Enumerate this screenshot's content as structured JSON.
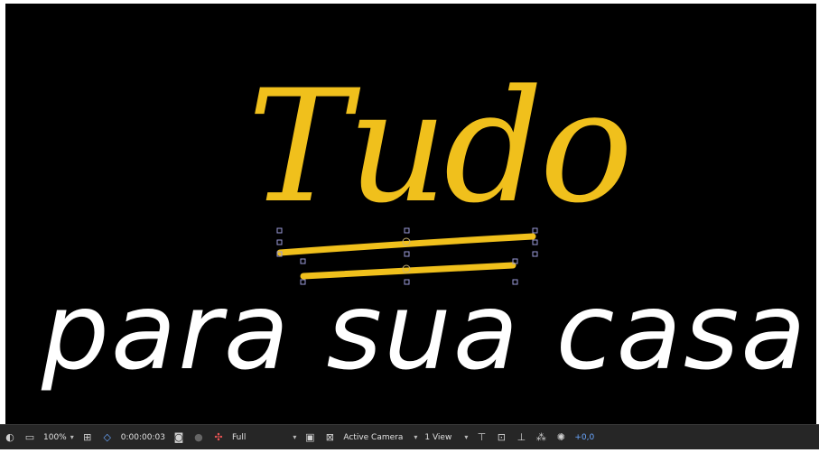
{
  "composition": {
    "title_line1": "Tudo",
    "title_line2": "para sua casa",
    "accent_color": "#f0c01c",
    "text_color": "#ffffff",
    "background": "#000000"
  },
  "toolbar": {
    "zoom": "100%",
    "timecode": "0:00:00:03",
    "resolution": "Full",
    "camera": "Active Camera",
    "views": "1 View",
    "exposure": "+0,0",
    "icons": [
      "toggle-alpha-icon",
      "monitor-icon",
      "grid-icon",
      "mask-icon",
      "snapshot-icon",
      "show-snapshot-icon",
      "color-icon",
      "region-icon",
      "transparency-icon",
      "views-icon",
      "reset-icon",
      "3d-icon",
      "flowchart-icon",
      "exposure-icon"
    ]
  }
}
